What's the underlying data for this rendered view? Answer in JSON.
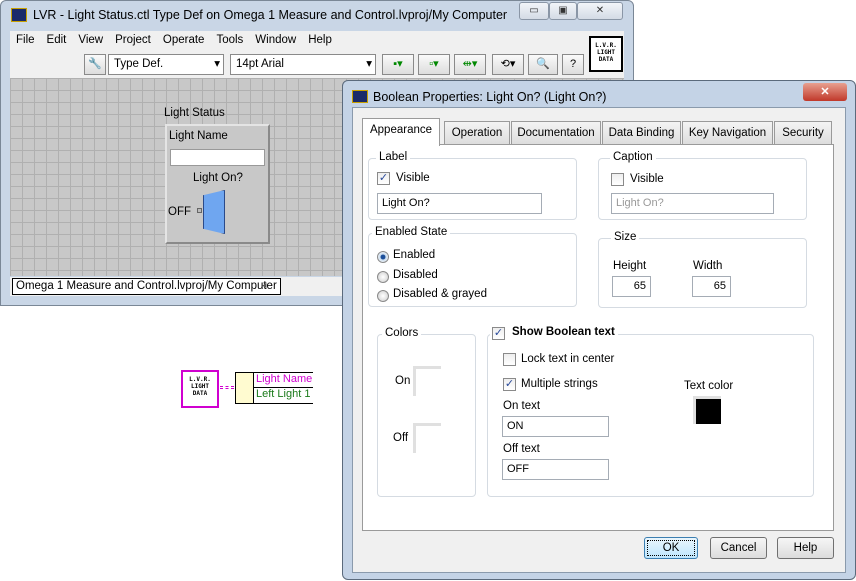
{
  "main_window": {
    "title": "LVR - Light Status.ctl Type Def on Omega 1 Measure and Control.lvproj/My Computer",
    "menu": [
      "File",
      "Edit",
      "View",
      "Project",
      "Operate",
      "Tools",
      "Window",
      "Help"
    ],
    "toolbar": {
      "type_select": "Type Def.",
      "font_select": "14pt Arial"
    },
    "panel": {
      "cluster_label": "Light Status",
      "string_label": "Light Name",
      "string_value": "",
      "boolean_label": "Light On?",
      "boolean_text": "OFF"
    },
    "status_path": "Omega 1 Measure and Control.lvproj/My Computer",
    "icon_text": "L.V.R. LIGHT DATA"
  },
  "diagram": {
    "bundle_items": [
      "Light Name",
      "Left Light 1"
    ],
    "colors": {
      "wire": "#d000d0",
      "item1": "#d000d0",
      "item2": "#1a7a1a"
    }
  },
  "dialog": {
    "title": "Boolean Properties: Light On? (Light On?)",
    "tabs": [
      "Appearance",
      "Operation",
      "Documentation",
      "Data Binding",
      "Key Navigation",
      "Security"
    ],
    "active_tab": "Appearance",
    "label": {
      "group": "Label",
      "visible_label": "Visible",
      "visible": true,
      "value": "Light On?"
    },
    "caption": {
      "group": "Caption",
      "visible_label": "Visible",
      "visible": false,
      "value": "Light On?"
    },
    "enabled_state": {
      "group": "Enabled State",
      "options": [
        "Enabled",
        "Disabled",
        "Disabled & grayed"
      ],
      "selected": "Enabled"
    },
    "size": {
      "group": "Size",
      "height_label": "Height",
      "height": "65",
      "width_label": "Width",
      "width": "65"
    },
    "colors": {
      "group": "Colors",
      "on_label": "On",
      "off_label": "Off"
    },
    "boolean_text": {
      "group": "Show Boolean text",
      "show": true,
      "lock_label": "Lock text in center",
      "lock": false,
      "multiple_label": "Multiple strings",
      "multiple": true,
      "on_label": "On text",
      "on_value": "ON",
      "off_label": "Off text",
      "off_value": "OFF",
      "text_color_label": "Text color",
      "text_color": "#000000"
    },
    "buttons": {
      "ok": "OK",
      "cancel": "Cancel",
      "help": "Help"
    }
  }
}
